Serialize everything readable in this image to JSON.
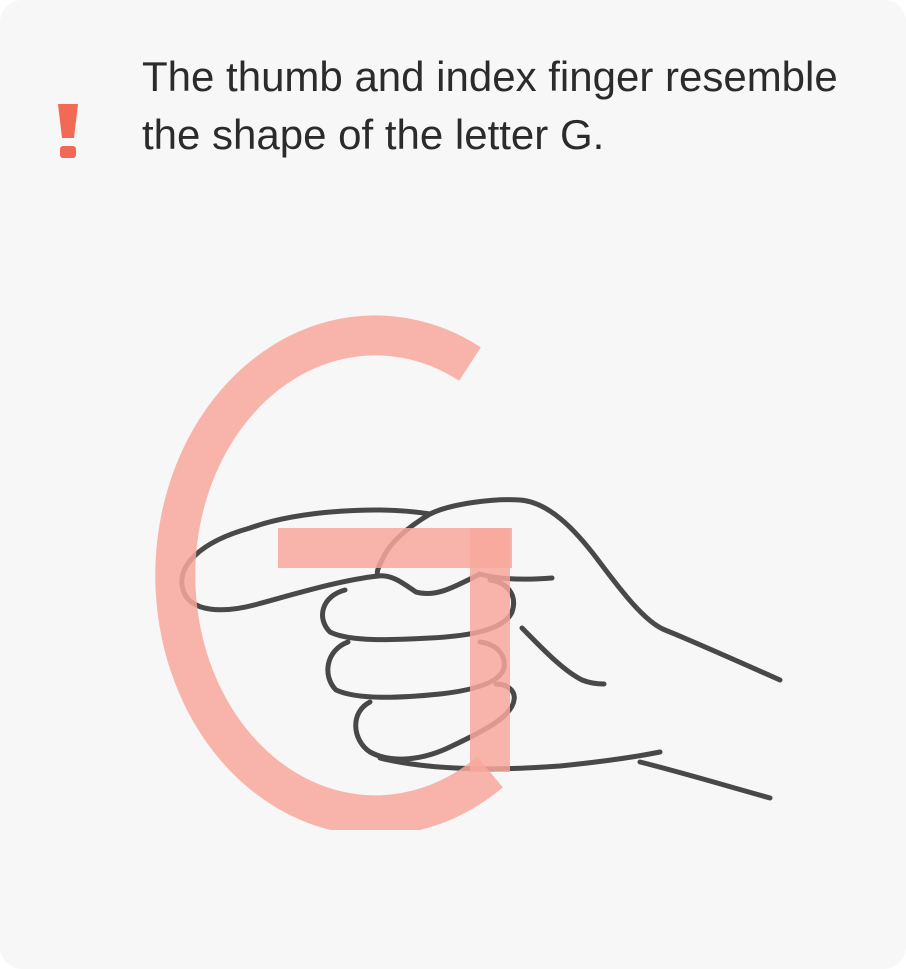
{
  "tip": {
    "icon": "exclamation-icon",
    "text": "The thumb and index finger resemble the shape of the letter G."
  },
  "illustration": {
    "subject": "hand-pointing-sideways",
    "overlay_letter": "G",
    "colors": {
      "accent": "#f26a55",
      "overlay": "#f8a89c",
      "line": "#3a3a3a",
      "background": "#f7f7f7",
      "text": "#2b2b2b"
    }
  }
}
